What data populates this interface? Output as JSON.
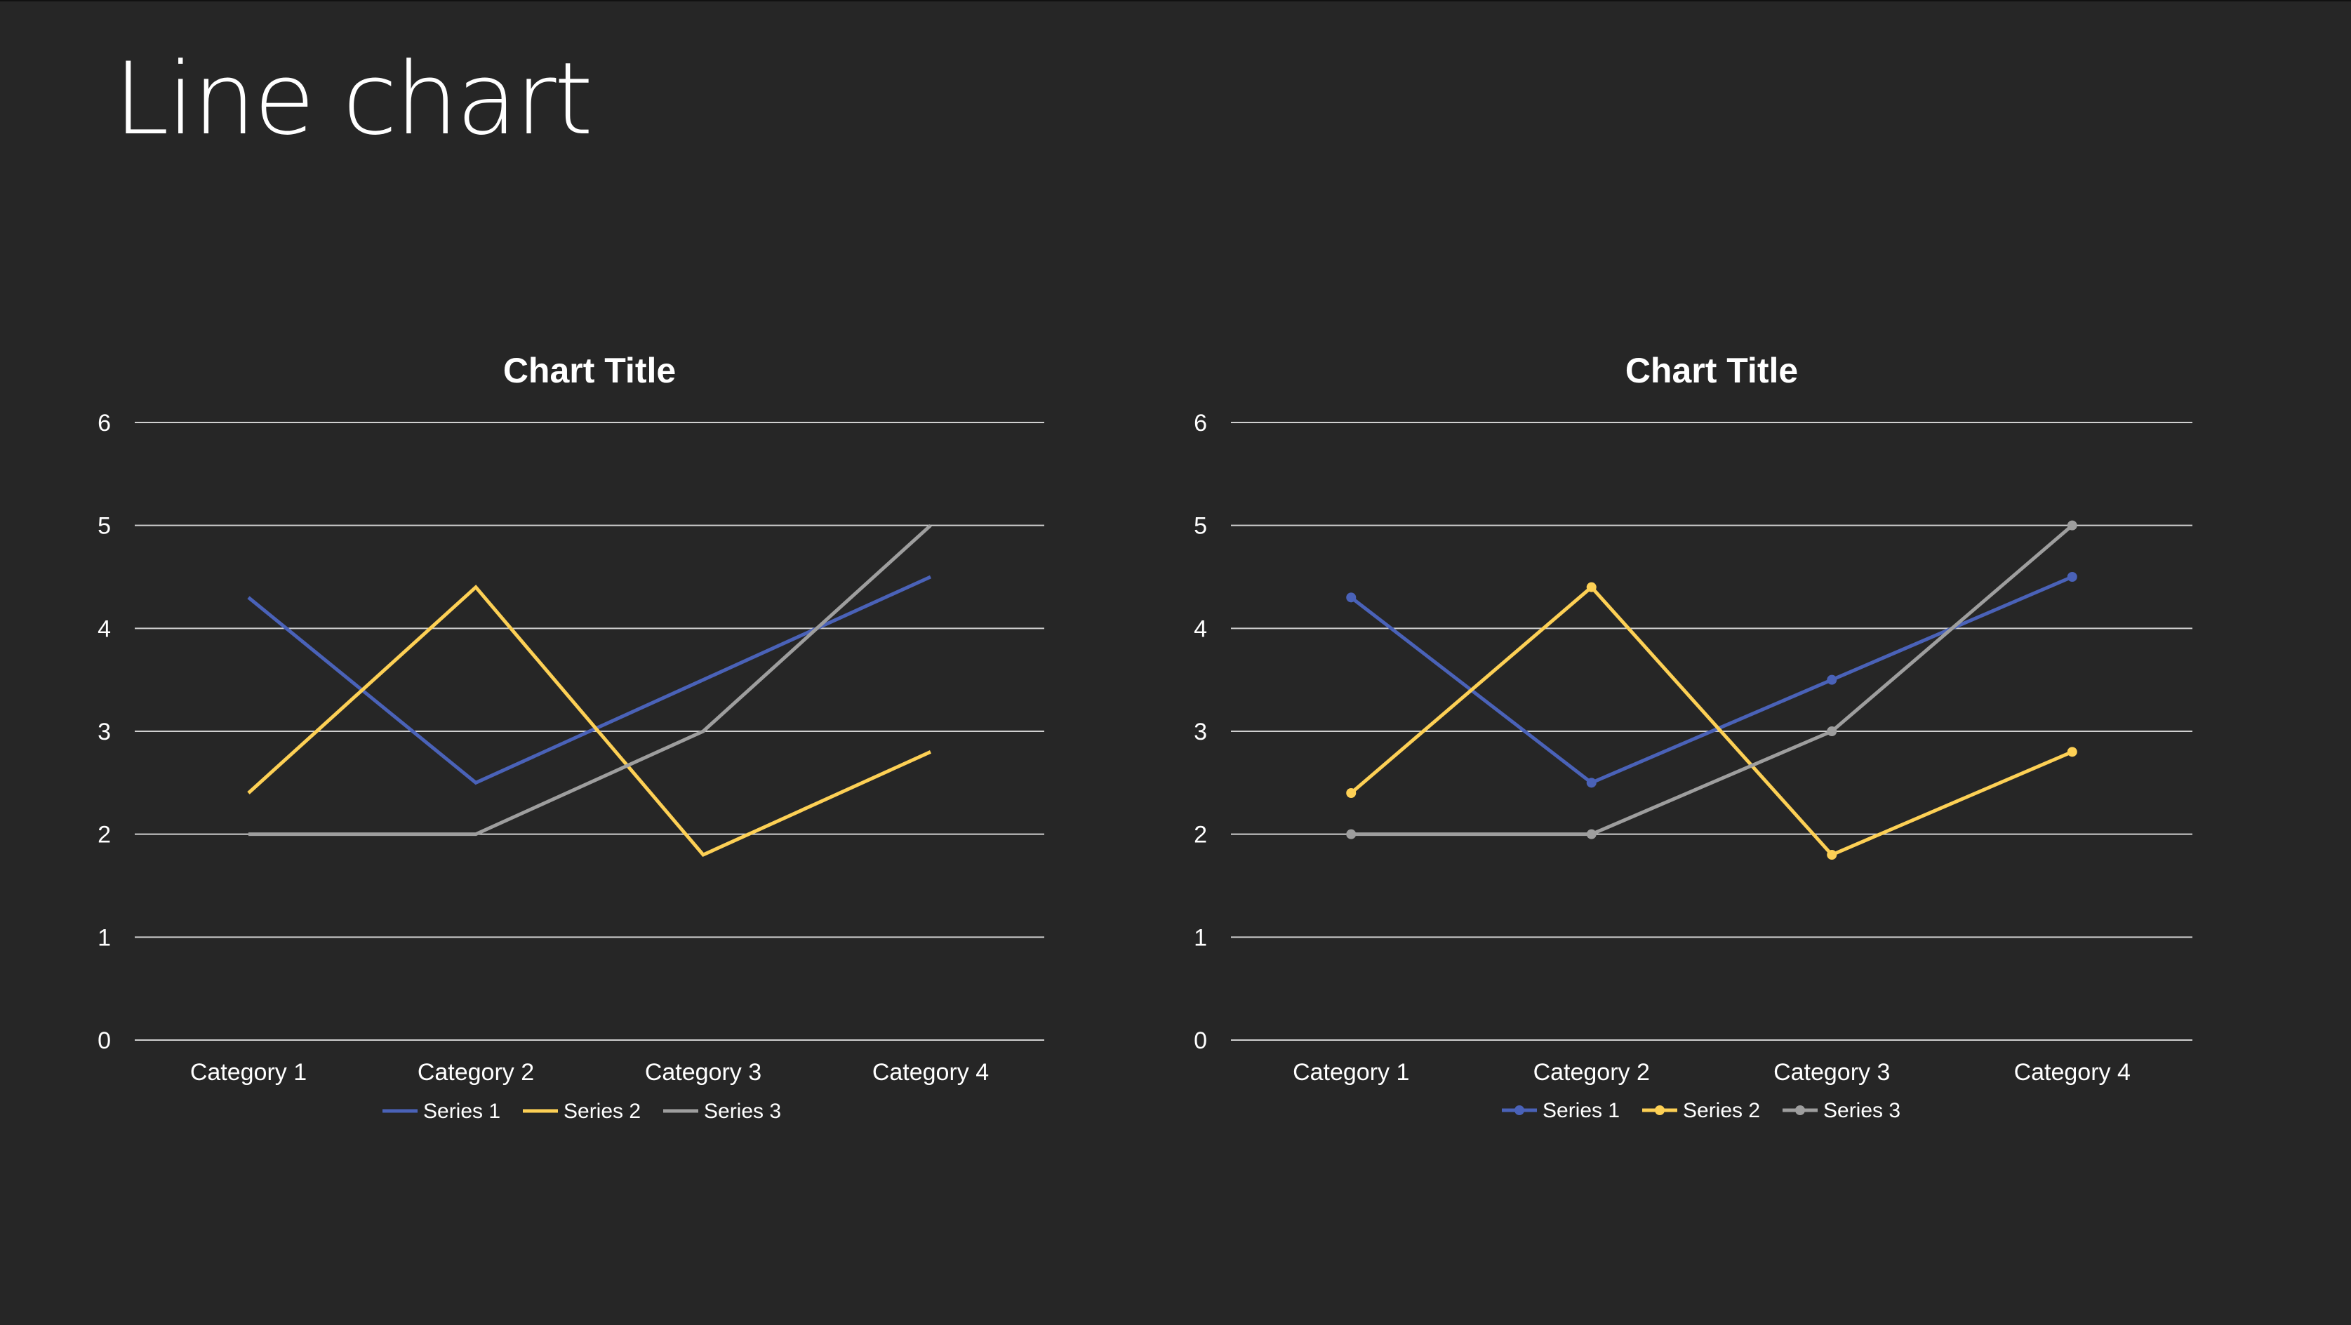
{
  "slide": {
    "title": "Line chart",
    "background": "#262626"
  },
  "chart_data": [
    {
      "type": "line",
      "title": "Chart Title",
      "xlabel": "",
      "ylabel": "",
      "categories": [
        "Category 1",
        "Category 2",
        "Category 3",
        "Category 4"
      ],
      "ylim": [
        0,
        6
      ],
      "yticks": [
        0,
        1,
        2,
        3,
        4,
        5,
        6
      ],
      "grid": true,
      "markers": false,
      "legend": "bottom",
      "series": [
        {
          "name": "Series 1",
          "values": [
            4.3,
            2.5,
            3.5,
            4.5
          ],
          "color": "#4a62b8"
        },
        {
          "name": "Series 2",
          "values": [
            2.4,
            4.4,
            1.8,
            2.8
          ],
          "color": "#fdd055"
        },
        {
          "name": "Series 3",
          "values": [
            2,
            2,
            3,
            5
          ],
          "color": "#9e9e9e"
        }
      ]
    },
    {
      "type": "line",
      "title": "Chart Title",
      "xlabel": "",
      "ylabel": "",
      "categories": [
        "Category 1",
        "Category 2",
        "Category 3",
        "Category 4"
      ],
      "ylim": [
        0,
        6
      ],
      "yticks": [
        0,
        1,
        2,
        3,
        4,
        5,
        6
      ],
      "grid": true,
      "markers": true,
      "legend": "bottom",
      "series": [
        {
          "name": "Series 1",
          "values": [
            4.3,
            2.5,
            3.5,
            4.5
          ],
          "color": "#4a62b8"
        },
        {
          "name": "Series 2",
          "values": [
            2.4,
            4.4,
            1.8,
            2.8
          ],
          "color": "#fdd055"
        },
        {
          "name": "Series 3",
          "values": [
            2,
            2,
            3,
            5
          ],
          "color": "#9e9e9e"
        }
      ]
    }
  ]
}
